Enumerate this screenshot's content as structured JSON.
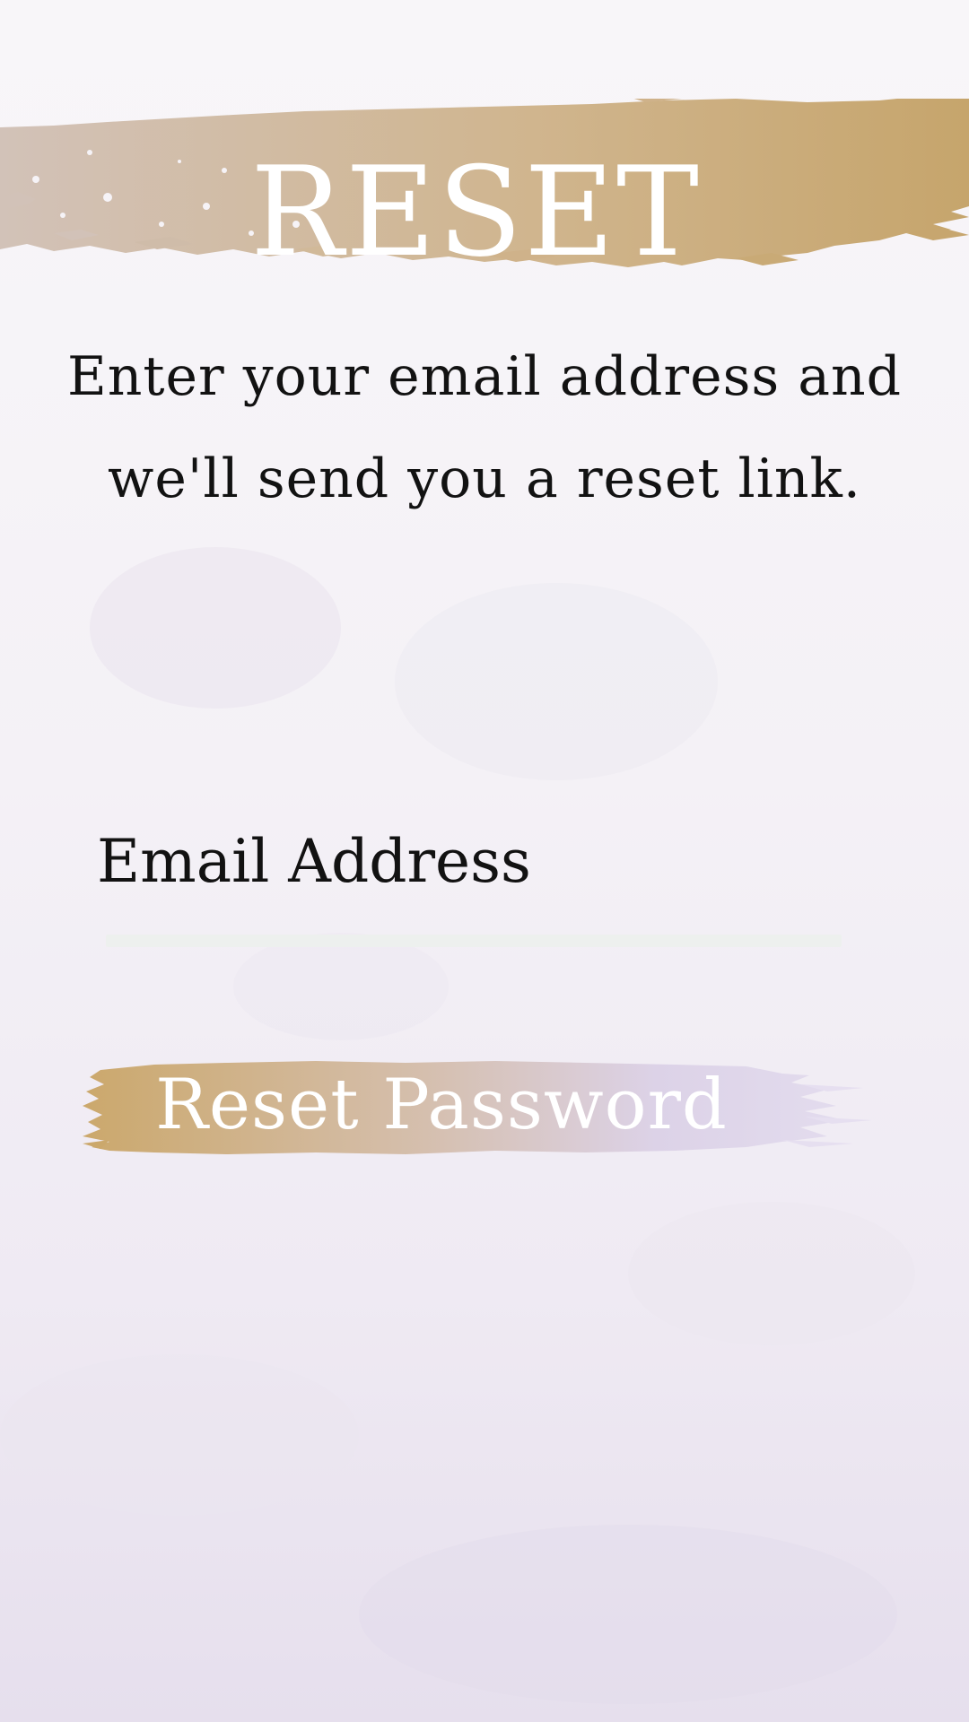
{
  "header": {
    "title": "RESET"
  },
  "instructions": {
    "line1": "Enter your email address and",
    "line2": "we'll send you a reset link."
  },
  "email": {
    "placeholder": "Email Address",
    "value": ""
  },
  "actions": {
    "reset_label": "Reset Password"
  },
  "colors": {
    "gold": "#c8a46c",
    "taupe": "#cfbcb2",
    "lavender": "#d9d0e6",
    "background": "#f4f1f6",
    "text": "#121212"
  }
}
